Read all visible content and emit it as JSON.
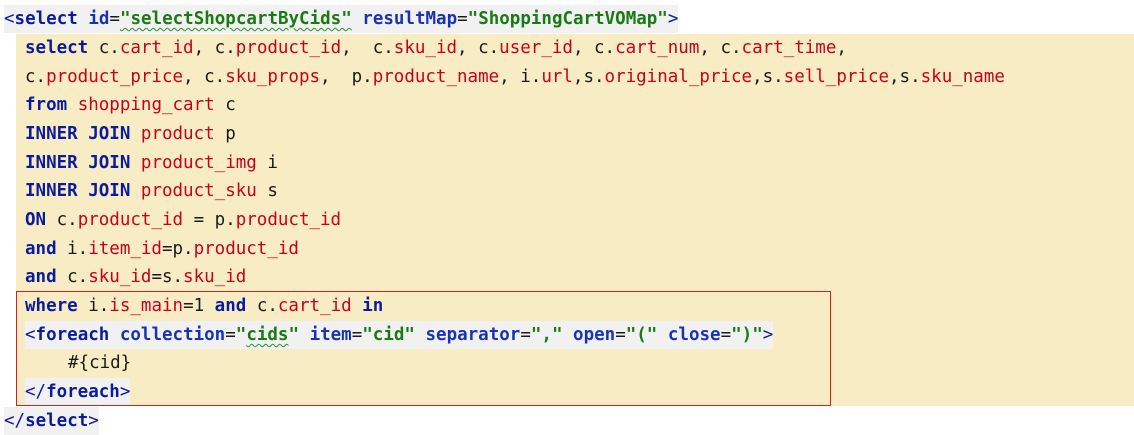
{
  "editor": {
    "select_open": {
      "lt": "<",
      "tag": "select",
      "id_attr": "id",
      "eq1": "=",
      "id_value": "\"selectShopcartByCids\"",
      "resultmap_attr": "resultMap",
      "eq2": "=",
      "resultmap_value": "\"ShoppingCartVOMap\"",
      "gt": ">"
    },
    "line1": {
      "kw": "select",
      "t1": " c.",
      "c1": "cart_id",
      "t2": ", c.",
      "c2": "product_id",
      "t3": ",  c.",
      "c3": "sku_id",
      "t4": ", c.",
      "c4": "user_id",
      "t5": ", c.",
      "c5": "cart_num",
      "t6": ", c.",
      "c6": "cart_time",
      "t7": ","
    },
    "line2": {
      "t1": "c.",
      "c1": "product_price",
      "t2": ", c.",
      "c2": "sku_props",
      "t3": ",  p.",
      "c3": "product_name",
      "t4": ", i.",
      "c4": "url",
      "t5": ",s.",
      "c5": "original_price",
      "t6": ",s.",
      "c6": "sell_price",
      "t7": ",s.",
      "c7": "sku_name"
    },
    "line3": {
      "kw": "from",
      "table": "shopping_cart",
      "alias": " c"
    },
    "line4": {
      "kw": "INNER JOIN",
      "table": "product",
      "alias": " p"
    },
    "line5": {
      "kw": "INNER JOIN",
      "table": "product_img",
      "alias": " i"
    },
    "line6": {
      "kw": "INNER JOIN",
      "table": "product_sku",
      "alias": " s"
    },
    "line7": {
      "kw": "ON",
      "t1": " c.",
      "c1": "product_id",
      "t2": " = p.",
      "c2": "product_id"
    },
    "line8": {
      "kw": "and",
      "t1": " i.",
      "c1": "item_id",
      "t2": "=p.",
      "c2": "product_id"
    },
    "line9": {
      "kw": "and",
      "t1": " c.",
      "c1": "sku_id",
      "t2": "=s.",
      "c2": "sku_id"
    },
    "line10": {
      "kw": "where",
      "t1": " i.",
      "c1": "is_main",
      "t2": "=1 ",
      "kw2": "and",
      "t3": " c.",
      "c2": "cart_id",
      "t4": " ",
      "kw3": "in"
    },
    "foreach_open": {
      "lt": "<",
      "tag": "foreach",
      "a1": "collection",
      "e1": "=",
      "v1": "\"cids\"",
      "a2": "item",
      "e2": "=",
      "v2": "\"cid\"",
      "a3": "separator",
      "e3": "=",
      "v3": "\",\"",
      "a4": "open",
      "e4": "=",
      "v4": "\"(\"",
      "a5": "close",
      "e5": "=",
      "v5": "\")\"",
      "gt": ">"
    },
    "param": "#{cid}",
    "foreach_close": {
      "lt": "</",
      "tag": "foreach",
      "gt": ">"
    },
    "select_close": {
      "lt": "</",
      "tag": "select",
      "gt": ">"
    }
  },
  "colors": {
    "sql_background": "#f7ecc4",
    "keyword": "#0a1b9e",
    "column": "#c8001e",
    "string": "#1a7a13",
    "highlight_border": "#d32020"
  }
}
